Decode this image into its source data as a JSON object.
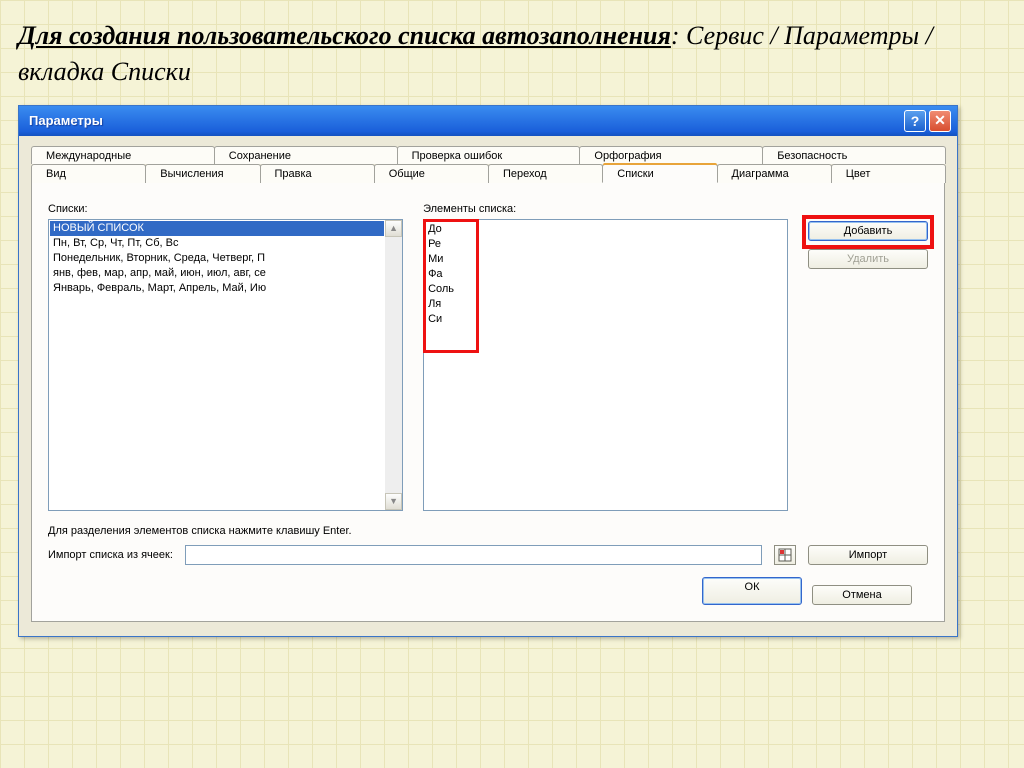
{
  "heading": {
    "emph": "Для создания пользовательского списка автозаполнения",
    "tail": ": Сервис / Параметры / вкладка Списки"
  },
  "titlebar": {
    "title": "Параметры"
  },
  "tabs_row1": [
    "Международные",
    "Сохранение",
    "Проверка ошибок",
    "Орфография",
    "Безопасность"
  ],
  "tabs_row2": [
    "Вид",
    "Вычисления",
    "Правка",
    "Общие",
    "Переход",
    "Списки",
    "Диаграмма",
    "Цвет"
  ],
  "active_tab": "Списки",
  "labels": {
    "lists": "Списки:",
    "elements": "Элементы списка:",
    "hint": "Для разделения элементов списка нажмите клавишу Enter.",
    "import": "Импорт списка из ячеек:"
  },
  "lists": [
    "НОВЫЙ СПИСОК",
    "Пн, Вт, Ср, Чт, Пт, Сб, Вс",
    "Понедельник, Вторник, Среда, Четверг, П",
    "янв, фев, мар, апр, май, июн, июл, авг, се",
    "Январь, Февраль, Март, Апрель, Май, Ию"
  ],
  "selected_list_index": 0,
  "elements_text": "До\nРе\nМи\nФа\nСоль\nЛя\nСи",
  "buttons": {
    "add": "Добавить",
    "delete": "Удалить",
    "import": "Импорт",
    "ok": "ОК",
    "cancel": "Отмена"
  },
  "import_value": ""
}
